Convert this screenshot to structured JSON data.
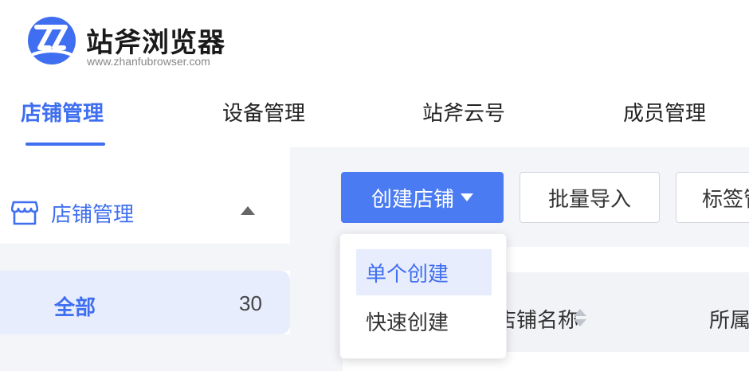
{
  "brand": {
    "title": "站斧浏览器",
    "url": "www.zhanfubrowser.com",
    "color": "#3f6ff0"
  },
  "nav": {
    "tabs": [
      {
        "label": "店铺管理",
        "active": true
      },
      {
        "label": "设备管理",
        "active": false
      },
      {
        "label": "站斧云号",
        "active": false
      },
      {
        "label": "成员管理",
        "active": false
      }
    ]
  },
  "sidebar": {
    "title": "店铺管理",
    "icon": "store-icon",
    "items": [
      {
        "label": "全部",
        "count": "30",
        "selected": true
      }
    ]
  },
  "toolbar": {
    "create_label": "创建店铺",
    "import_label": "批量导入",
    "tag_label": "标签管理"
  },
  "dropdown": {
    "items": [
      {
        "label": "单个创建",
        "selected": true
      },
      {
        "label": "快速创建",
        "selected": false
      }
    ]
  },
  "table": {
    "columns": [
      "店铺名称",
      "所属"
    ]
  }
}
